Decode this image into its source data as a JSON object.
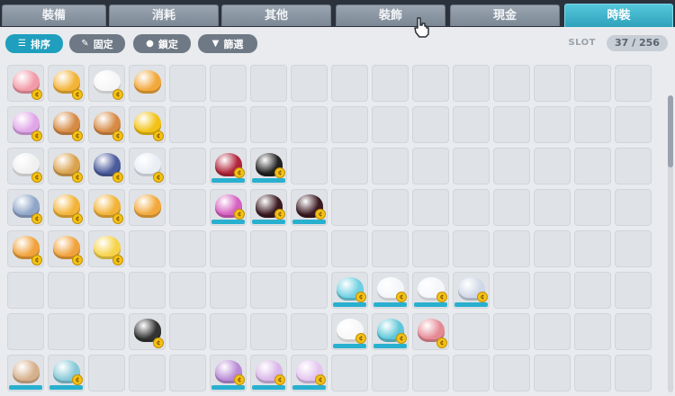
{
  "tabs": [
    {
      "label": "裝備",
      "active": false
    },
    {
      "label": "消耗",
      "active": false
    },
    {
      "label": "其他",
      "active": false
    },
    {
      "label": "裝飾",
      "active": false
    },
    {
      "label": "現金",
      "active": false
    },
    {
      "label": "時裝",
      "active": true
    }
  ],
  "toolbar": {
    "sort_label": "排序",
    "pin_label": "固定",
    "lock_label": "鎖定",
    "filter_label": "篩選"
  },
  "slot": {
    "label": "SLOT",
    "used": "37",
    "total": "/256",
    "text": "37 / 256"
  },
  "colors": {
    "accent": "#2ea2bb",
    "bar": "#29b0cf",
    "coin": "#f3c216"
  },
  "items": [
    {
      "row": 0,
      "col": 0,
      "icon": "pink-ribbon-icon",
      "color": "#f29aa8",
      "coin": true
    },
    {
      "row": 0,
      "col": 1,
      "icon": "yellow-hat-icon",
      "color": "#f2b337",
      "coin": true
    },
    {
      "row": 0,
      "col": 2,
      "icon": "white-outfit-icon",
      "color": "#f6f6f6",
      "coin": true
    },
    {
      "row": 0,
      "col": 3,
      "icon": "bread-icon",
      "color": "#f2a83a",
      "coin": false
    },
    {
      "row": 1,
      "col": 0,
      "icon": "sparkle-accessory-icon",
      "color": "#e0a6e8",
      "coin": true
    },
    {
      "row": 1,
      "col": 1,
      "icon": "brown-hat-icon",
      "color": "#d68b45",
      "coin": true
    },
    {
      "row": 1,
      "col": 2,
      "icon": "brown-hat-icon",
      "color": "#d68b45",
      "coin": true
    },
    {
      "row": 1,
      "col": 3,
      "icon": "gold-medal-icon",
      "color": "#f3c216",
      "coin": true
    },
    {
      "row": 2,
      "col": 0,
      "icon": "white-shoe-icon",
      "color": "#f0f0f0",
      "coin": true
    },
    {
      "row": 2,
      "col": 1,
      "icon": "clock-hat-icon",
      "color": "#d9a24d",
      "coin": true
    },
    {
      "row": 2,
      "col": 2,
      "icon": "navy-helmet-icon",
      "color": "#4b5c9c",
      "coin": true
    },
    {
      "row": 2,
      "col": 3,
      "icon": "white-top-icon",
      "color": "#e9eef5",
      "coin": true
    },
    {
      "row": 2,
      "col": 5,
      "icon": "red-creature-icon",
      "color": "#b1263b",
      "coin": true,
      "bar": true
    },
    {
      "row": 2,
      "col": 6,
      "icon": "black-wing-icon",
      "color": "#222222",
      "coin": true,
      "bar": true
    },
    {
      "row": 3,
      "col": 0,
      "icon": "blue-weapon-icon",
      "color": "#8fa6c8",
      "coin": true
    },
    {
      "row": 3,
      "col": 1,
      "icon": "yellow-hat-icon",
      "color": "#f2b337",
      "coin": true
    },
    {
      "row": 3,
      "col": 2,
      "icon": "yellow-hat-icon",
      "color": "#f2b337",
      "coin": true
    },
    {
      "row": 3,
      "col": 3,
      "icon": "bread-icon",
      "color": "#f2a83a",
      "coin": false
    },
    {
      "row": 3,
      "col": 5,
      "icon": "pink-dress-icon",
      "color": "#d65fc0",
      "coin": true,
      "bar": true
    },
    {
      "row": 3,
      "col": 6,
      "icon": "dark-cape-icon",
      "color": "#3b1a22",
      "coin": true,
      "bar": true
    },
    {
      "row": 3,
      "col": 7,
      "icon": "dark-cape-icon",
      "color": "#3b1a22",
      "coin": true,
      "bar": true
    },
    {
      "row": 4,
      "col": 0,
      "icon": "orange-hat-icon",
      "color": "#f0a23c",
      "coin": true
    },
    {
      "row": 4,
      "col": 1,
      "icon": "orange-hat-icon",
      "color": "#f0a23c",
      "coin": true
    },
    {
      "row": 4,
      "col": 2,
      "icon": "star-accessory-icon",
      "color": "#f6d34a",
      "coin": true
    },
    {
      "row": 5,
      "col": 8,
      "icon": "blue-ears-icon",
      "color": "#6fd0e2",
      "coin": true,
      "bar": true
    },
    {
      "row": 5,
      "col": 9,
      "icon": "white-glove-icon",
      "color": "#f4f6fa",
      "coin": true,
      "bar": true
    },
    {
      "row": 5,
      "col": 10,
      "icon": "white-earring-icon",
      "color": "#f4f6fa",
      "coin": true,
      "bar": true
    },
    {
      "row": 5,
      "col": 11,
      "icon": "glasses-icon",
      "color": "#cfd8e6",
      "coin": true,
      "bar": true
    },
    {
      "row": 6,
      "col": 3,
      "icon": "glasses-icon",
      "color": "#333333",
      "coin": true
    },
    {
      "row": 6,
      "col": 8,
      "icon": "white-mask-icon",
      "color": "#f8f8f8",
      "coin": true,
      "bar": true
    },
    {
      "row": 6,
      "col": 9,
      "icon": "blue-tail-icon",
      "color": "#5dc7d8",
      "coin": true,
      "bar": true
    },
    {
      "row": 6,
      "col": 10,
      "icon": "pink-costume-icon",
      "color": "#e58a95",
      "coin": true
    },
    {
      "row": 7,
      "col": 0,
      "icon": "brown-cloth-icon",
      "color": "#d6b08c",
      "coin": false,
      "bar": true
    },
    {
      "row": 7,
      "col": 1,
      "icon": "pastel-accessory-icon",
      "color": "#86c9d8",
      "coin": true,
      "bar": true
    },
    {
      "row": 7,
      "col": 5,
      "icon": "purple-shoe-icon",
      "color": "#b98ad6",
      "coin": true,
      "bar": true
    },
    {
      "row": 7,
      "col": 6,
      "icon": "lilac-dress-icon",
      "color": "#d9b7e8",
      "coin": true,
      "bar": true
    },
    {
      "row": 7,
      "col": 7,
      "icon": "lilac-dress-icon",
      "color": "#e3c6ef",
      "coin": true,
      "bar": true
    }
  ]
}
